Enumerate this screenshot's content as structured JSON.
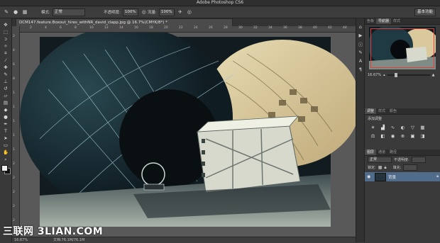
{
  "app": {
    "title": "Adobe Photoshop CS6"
  },
  "options_bar": {
    "mode_label": "模式:",
    "mode_value": "正常",
    "opacity_label": "不透明度:",
    "opacity_value": "100%",
    "flow_label": "流量:",
    "flow_value": "100%",
    "workspace": "基本功能"
  },
  "document": {
    "tab_title": "DCM147.feature.Boxout_hires_withNR_david_clapp.jpg @ 16.7%(CMYK/8*) *",
    "zoom": "16.67%",
    "doc_size": "文档:76.1M/76.1M"
  },
  "rulers": {
    "h": [
      "2",
      "4",
      "6",
      "8",
      "10",
      "12",
      "14",
      "16",
      "18",
      "20",
      "22",
      "24",
      "26",
      "28",
      "30",
      "32",
      "34",
      "36",
      "38",
      "40",
      "42",
      "44"
    ],
    "v": [
      "2",
      "4",
      "6",
      "8",
      "1",
      "1",
      "1",
      "1",
      "1",
      "2",
      "2",
      "2",
      "2",
      "2"
    ]
  },
  "panels": {
    "top_tabs": [
      "色板",
      "导航器",
      "样式"
    ],
    "navigator_zoom": "16.67%",
    "adjust_tabs": [
      "调整",
      "样式",
      "颜色"
    ],
    "adjust_title": "添加调整",
    "layers_tabs": [
      "图层",
      "通道",
      "路径"
    ],
    "blend_mode": "正常",
    "opacity_label": "不透明度:",
    "fill_label": "填充:",
    "lock_label": "锁定:",
    "layer_name": "背景"
  },
  "watermark": "三联网 3LIAN.COM",
  "colors": {
    "accent_layer": "#516b8a",
    "navigator_frame": "#e0403a"
  }
}
